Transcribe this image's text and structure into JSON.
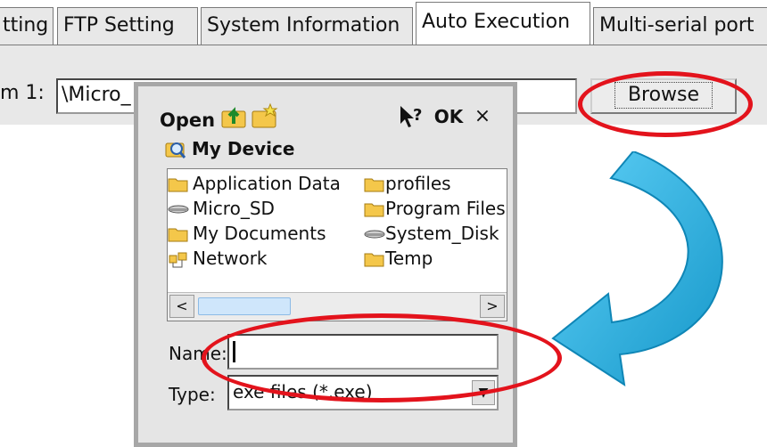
{
  "tabs": [
    {
      "label": "tting",
      "active": false
    },
    {
      "label": "FTP Setting",
      "active": false
    },
    {
      "label": "System Information",
      "active": false
    },
    {
      "label": "Auto Execution",
      "active": true
    },
    {
      "label": "Multi-serial port",
      "active": false
    }
  ],
  "form": {
    "item_label": "m 1:",
    "path_value": "\\Micro_",
    "browse_label": "Browse"
  },
  "dialog": {
    "title": "Open",
    "toolbar": {
      "up_icon": "folder-up-icon",
      "new_folder_icon": "new-folder-icon",
      "help_icon": "help-pointer-icon",
      "ok_label": "OK",
      "close_label": "×"
    },
    "location": {
      "icon": "device-icon",
      "label": "My Device"
    },
    "files": [
      {
        "label": "Application Data",
        "icon": "folder-icon"
      },
      {
        "label": "Micro_SD",
        "icon": "drive-icon"
      },
      {
        "label": "My Documents",
        "icon": "folder-icon"
      },
      {
        "label": "Network",
        "icon": "network-icon"
      },
      {
        "label": "profiles",
        "icon": "folder-icon"
      },
      {
        "label": "Program Files",
        "icon": "folder-icon"
      },
      {
        "label": "System_Disk",
        "icon": "drive-icon"
      },
      {
        "label": "Temp",
        "icon": "folder-icon"
      }
    ],
    "scroll": {
      "left_glyph": "<",
      "right_glyph": ">"
    },
    "name_label": "Name:",
    "name_value": "",
    "type_label": "Type:",
    "type_value": "exe files (*.exe)"
  },
  "colors": {
    "annotation": "#e3131c",
    "arrow_light": "#5fd0f7",
    "arrow_dark": "#1597c9",
    "folder": "#f4c74a"
  }
}
